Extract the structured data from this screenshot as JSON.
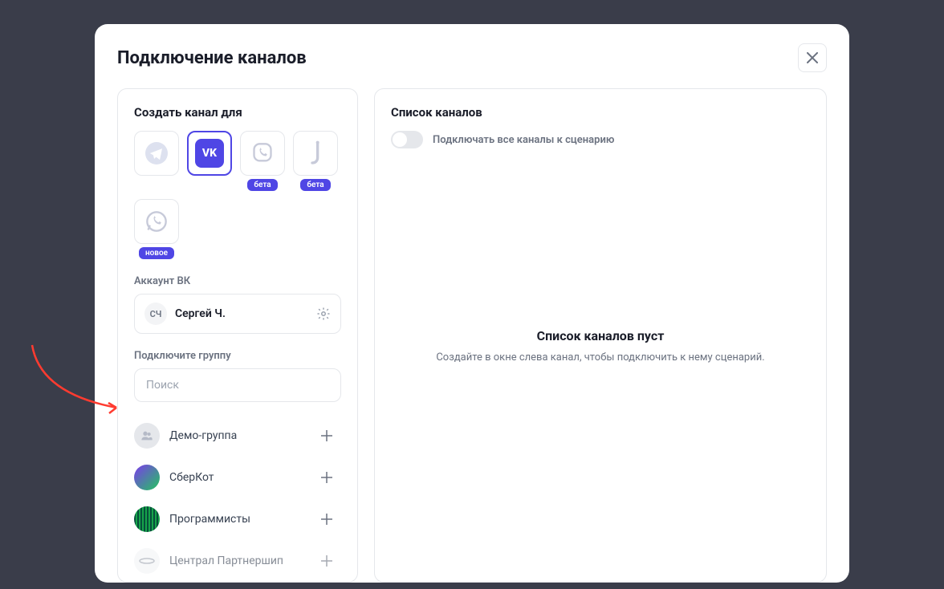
{
  "modal": {
    "title": "Подключение каналов"
  },
  "left": {
    "create_label": "Создать канал для",
    "channels": [
      {
        "id": "telegram",
        "badge": null,
        "selected": false
      },
      {
        "id": "vk",
        "badge": null,
        "selected": true
      },
      {
        "id": "viber",
        "badge": "бета",
        "selected": false
      },
      {
        "id": "jivo",
        "badge": "бета",
        "selected": false
      },
      {
        "id": "whatsapp",
        "badge": "новое",
        "selected": false
      }
    ],
    "account_label": "Аккаунт ВК",
    "account": {
      "initials": "СЧ",
      "name": "Сергей Ч."
    },
    "group_label": "Подключите группу",
    "search_placeholder": "Поиск",
    "groups": [
      {
        "name": "Демо-группа",
        "avatar": "default"
      },
      {
        "name": "СберКот",
        "avatar": "sberkot"
      },
      {
        "name": "Программисты",
        "avatar": "prog"
      },
      {
        "name": "Централ Партнершип",
        "avatar": "central"
      }
    ]
  },
  "right": {
    "list_label": "Список каналов",
    "toggle_label": "Подключать все каналы к сценарию",
    "empty_title": "Список каналов пуст",
    "empty_desc": "Создайте в окне слева канал, чтобы подключить к нему сценарий."
  }
}
